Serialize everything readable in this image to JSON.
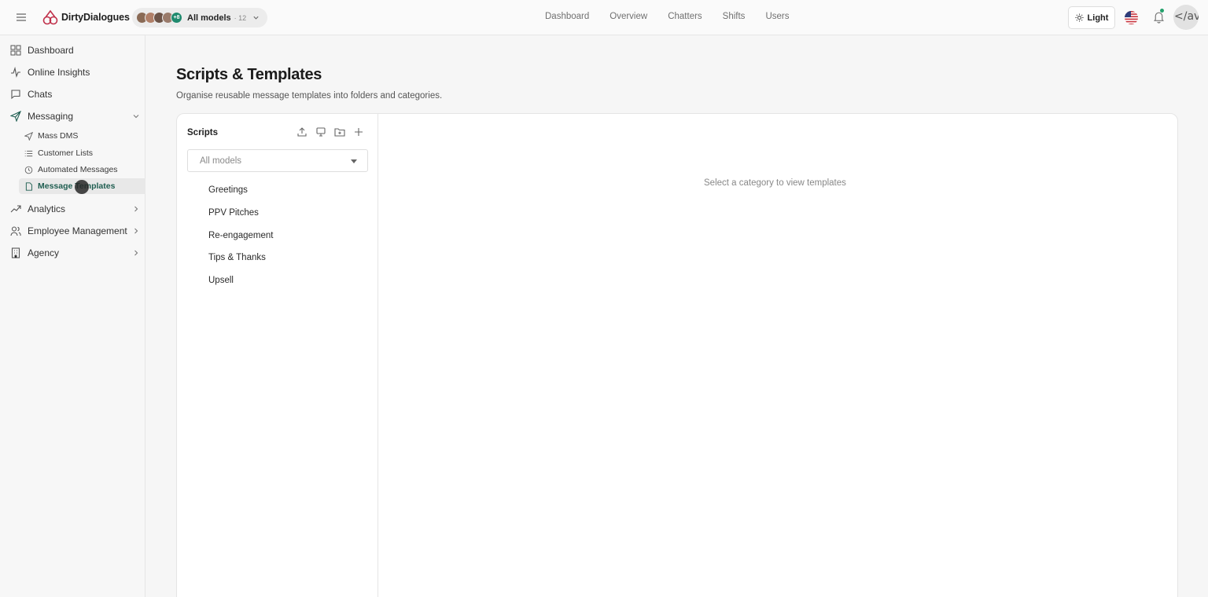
{
  "brand": {
    "name": "DirtyDialogues"
  },
  "model_selector": {
    "label": "All models",
    "count": "· 12",
    "overflow": "+8"
  },
  "top_nav": [
    "Dashboard",
    "Overview",
    "Chatters",
    "Shifts",
    "Users"
  ],
  "theme_toggle": {
    "label": "Light"
  },
  "user": {
    "avatar_text": "</ava"
  },
  "sidebar": {
    "items": [
      {
        "label": "Dashboard",
        "icon": "grid-icon"
      },
      {
        "label": "Online Insights",
        "icon": "activity-icon"
      },
      {
        "label": "Chats",
        "icon": "chat-bubble-icon"
      },
      {
        "label": "Messaging",
        "icon": "send-icon"
      },
      {
        "label": "Analytics",
        "icon": "trending-icon"
      },
      {
        "label": "Employee Management",
        "icon": "users-icon"
      },
      {
        "label": "Agency",
        "icon": "building-icon"
      }
    ],
    "messaging_sub": [
      {
        "label": "Mass DMS",
        "icon": "send-icon"
      },
      {
        "label": "Customer Lists",
        "icon": "list-icon"
      },
      {
        "label": "Automated Messages",
        "icon": "clock-icon"
      },
      {
        "label": "Message Templates",
        "icon": "file-icon",
        "active": true
      }
    ]
  },
  "page": {
    "title": "Scripts & Templates",
    "subtitle": "Organise reusable message templates into folders and categories."
  },
  "scripts_panel": {
    "title": "Scripts",
    "model_filter": "All models",
    "categories": [
      "Greetings",
      "PPV Pitches",
      "Re-engagement",
      "Tips & Thanks",
      "Upsell"
    ]
  },
  "detail": {
    "empty_message": "Select a category to view templates"
  },
  "colors": {
    "accent": "#1f5e51",
    "brand": "#c0304a",
    "notify": "#22a06b"
  }
}
